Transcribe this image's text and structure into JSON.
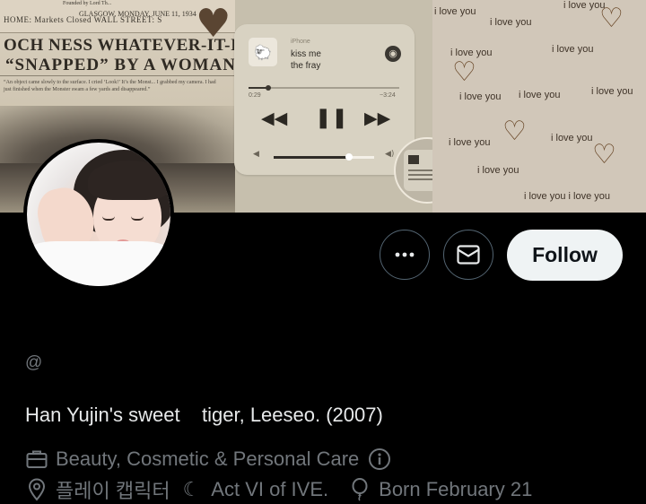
{
  "banner": {
    "newspaper": {
      "tiny_top": "Founded by Lord Th...",
      "dateline": "GLASGOW, MONDAY, JUNE 11, 1934",
      "sections": "HOME:  Markets  Closed        WALL STREET: S",
      "headline_1": "OCH  NESS  WHATEVER-IT-I",
      "headline_2": "“SNAPPED”  BY  A  WOMAN",
      "body_text": "“An object came slowly to the surface. I cried ‘Look!’ It’s the Monst... I grabbed my camera. I had just finished when the Monster swam a few yards and disappeared.”"
    },
    "player": {
      "source": "iPhone",
      "song": "kiss me",
      "artist": "the fray",
      "elapsed": "0:29",
      "remaining": "−3:24",
      "progress": 0.13,
      "volume": 0.75
    },
    "love_text": "i love you",
    "love_text_double": "i love you i love you"
  },
  "profile": {
    "handle": "@",
    "bio": "Han Yujin's sweet    tiger, Leeseo. (2007)",
    "category": "Beauty, Cosmetic & Personal Care",
    "location": "플레이 캡릭터",
    "moon": "☾",
    "tagline": "Act VI of IVE.",
    "birthday": "Born February 21"
  },
  "actions": {
    "more_icon": "more-horizontal-icon",
    "message_icon": "envelope-icon",
    "follow_label": "Follow"
  },
  "colors": {
    "background": "#000000",
    "primary_text": "#e7e9ea",
    "secondary_text": "#71767b",
    "button_border": "#536471",
    "follow_bg": "#eff3f4",
    "follow_text": "#0f1419"
  }
}
